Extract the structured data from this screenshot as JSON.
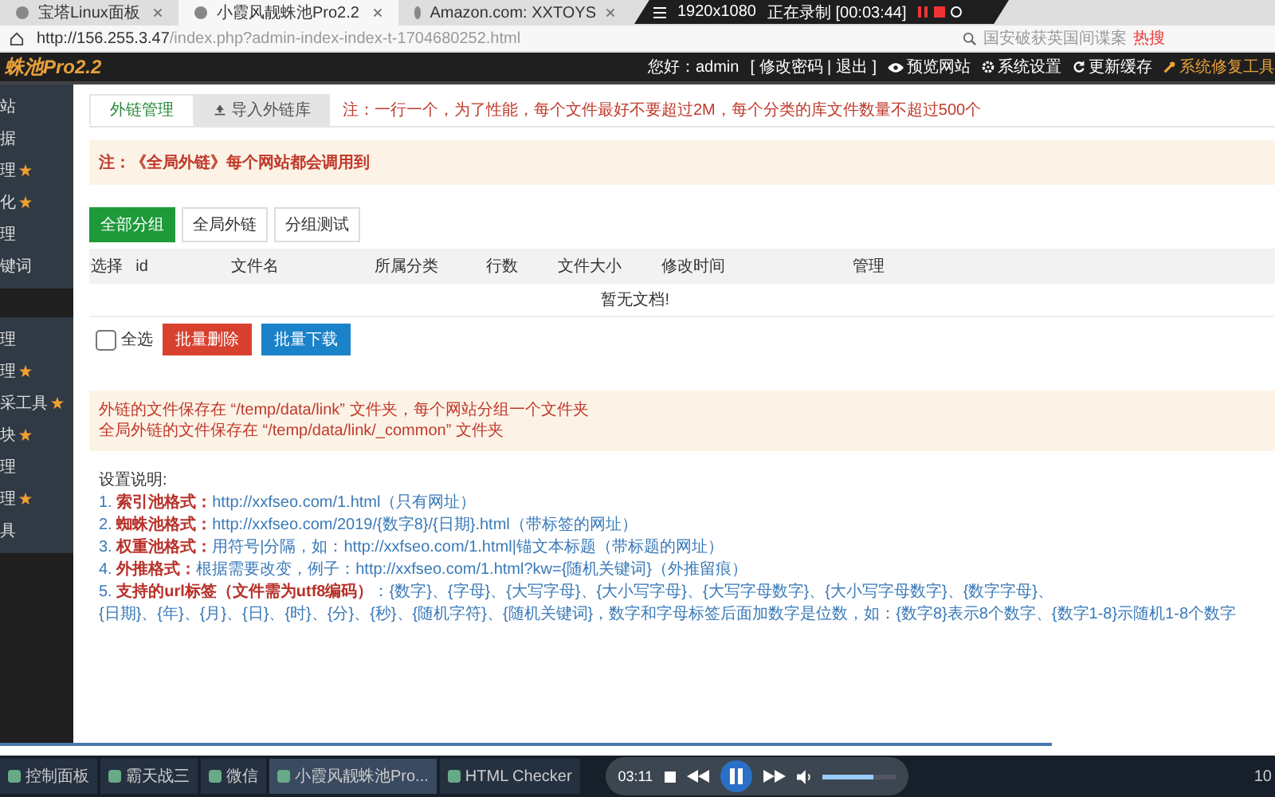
{
  "browser": {
    "tabs": [
      {
        "title": "宝塔Linux面板",
        "selected": false
      },
      {
        "title": "小霞风靓蛛池Pro2.2",
        "selected": true
      },
      {
        "title": "Amazon.com: XXTOYS",
        "selected": false
      }
    ],
    "recorder": {
      "resolution": "1920x1080",
      "status": "正在录制 [00:03:44]"
    },
    "url": {
      "host": "http://156.255.3.47",
      "path": "/index.php?admin-index-index-t-1704680252.html"
    },
    "search": {
      "placeholder": "国安破获英国间谍案",
      "badge": "热搜"
    }
  },
  "header": {
    "logo": "蛛池Pro2.2",
    "greeting": "您好：admin",
    "account_links": "[ 修改密码 | 退出 ]",
    "actions": [
      "预览网站",
      "系统设置",
      "更新缓存",
      "系统修复工具"
    ]
  },
  "sidebar": {
    "groups": [
      {
        "items": [
          {
            "label": "站",
            "starred": false
          },
          {
            "label": "据",
            "starred": false
          },
          {
            "label": "理",
            "starred": true
          },
          {
            "label": "化",
            "starred": true
          },
          {
            "label": "理",
            "starred": false
          },
          {
            "label": "键词",
            "starred": false
          }
        ]
      },
      {
        "items": [
          {
            "label": "理",
            "starred": false
          },
          {
            "label": "理",
            "starred": true
          },
          {
            "label": "采工具",
            "starred": true
          },
          {
            "label": "块",
            "starred": true
          },
          {
            "label": "理",
            "starred": false
          },
          {
            "label": "理",
            "starred": true
          },
          {
            "label": "具",
            "starred": false
          }
        ]
      }
    ]
  },
  "tabs": [
    {
      "label": "外链管理",
      "selected": true
    },
    {
      "label": "导入外链库",
      "selected": false
    }
  ],
  "tab_note": "注：一行一个，为了性能，每个文件最好不要超过2M，每个分类的库文件数量不超过500个",
  "notice": "注：《全局外链》每个网站都会调用到",
  "filters": [
    {
      "label": "全部分组",
      "selected": true
    },
    {
      "label": "全局外链",
      "selected": false
    },
    {
      "label": "分组测试",
      "selected": false
    }
  ],
  "table": {
    "columns": [
      "选择",
      "id",
      "文件名",
      "所属分类",
      "行数",
      "文件大小",
      "修改时间",
      "管理"
    ],
    "empty": "暂无文档!"
  },
  "select_all": {
    "label": "全选",
    "checked": false
  },
  "batch_buttons": [
    {
      "label": "批量删除",
      "kind": "delete"
    },
    {
      "label": "批量下载",
      "kind": "download"
    }
  ],
  "info": [
    "外链的文件保存在 “/temp/data/link” 文件夹，每个网站分组一个文件夹",
    "全局外链的文件保存在 “/temp/data/link/_common” 文件夹"
  ],
  "help": {
    "title": "设置说明:",
    "lines": [
      "1. **索引池格式：**http://xxfseo.com/1.html（只有网址）",
      "2. **蜘蛛池格式：**http://xxfseo.com/2019/{数字8}/{日期}.html（带标签的网址）",
      "3. **权重池格式：**用符号|分隔，如：http://xxfseo.com/1.html|锚文本标题（带标题的网址）",
      "4. **外推格式：**根据需要改变，例子：http://xxfseo.com/1.html?kw={随机关键词}（外推留痕）",
      "5. **支持的url标签（文件需为utf8编码）**：{数字}、{字母}、{大写字母}、{大小写字母}、{大写字母数字}、{大小写字母数字}、{数字字母}、",
      "{日期}、{年}、{月}、{日}、{时}、{分}、{秒}、{随机字符}、{随机关键词}，数字和字母标签后面加数字是位数，如：{数字8}表示8个数字、{数字1-8}示随机1-8个数字"
    ]
  },
  "player": {
    "time": "03:11",
    "volume": {
      "level": 0.7
    }
  },
  "taskbar": {
    "items": [
      {
        "label": "控制面板",
        "selected": false
      },
      {
        "label": "霸天战三",
        "selected": false
      },
      {
        "label": "微信",
        "selected": false
      },
      {
        "label": "小霞风靓蛛池Pro...",
        "selected": true
      },
      {
        "label": "HTML Checker",
        "selected": false
      }
    ],
    "clock": "10"
  }
}
